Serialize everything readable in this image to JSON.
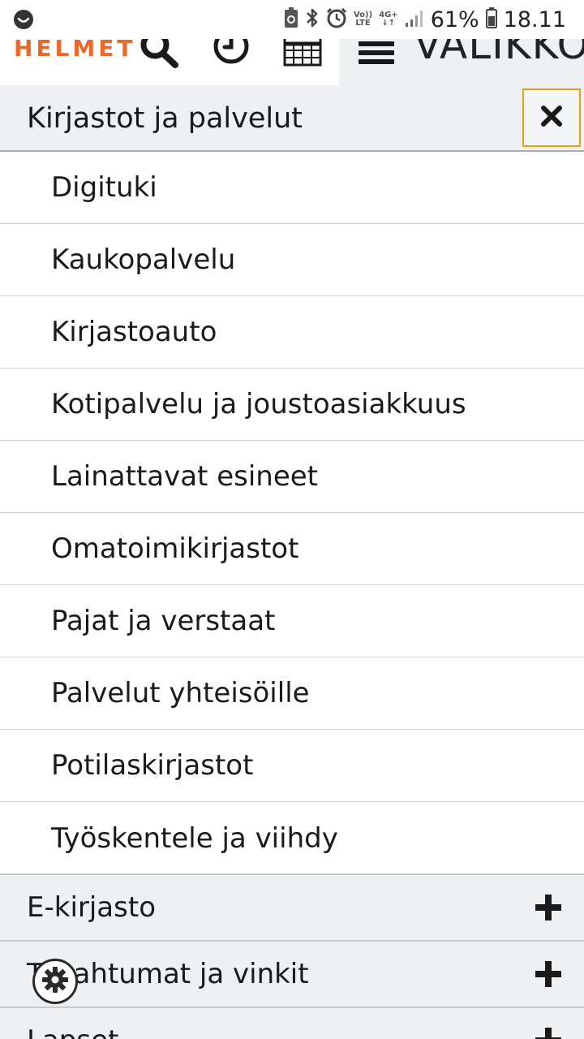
{
  "status_bar": {
    "battery_percent": "61%",
    "time": "18.11",
    "volte_line1": "Vo))",
    "volte_line2": "LTE",
    "network_line1": "4G+",
    "network_line2": "↓↑"
  },
  "header": {
    "logo_text": "HELMET",
    "menu_label": "VALIKKO"
  },
  "section": {
    "title": "Kirjastot ja palvelut"
  },
  "sub_items": [
    {
      "label": "Digituki"
    },
    {
      "label": "Kaukopalvelu"
    },
    {
      "label": "Kirjastoauto"
    },
    {
      "label": "Kotipalvelu ja joustoasiakkuus"
    },
    {
      "label": "Lainattavat esineet"
    },
    {
      "label": "Omatoimikirjastot"
    },
    {
      "label": "Pajat ja verstaat"
    },
    {
      "label": "Palvelut yhteisöille"
    },
    {
      "label": "Potilaskirjastot"
    },
    {
      "label": "Työskentele ja viihdy"
    }
  ],
  "categories": [
    {
      "label": "E-kirjasto"
    },
    {
      "label": "Tapahtumat ja vinkit"
    },
    {
      "label": "Lapset"
    }
  ],
  "colors": {
    "brand_orange": "#e9692c",
    "focus_outline": "#e0a21e",
    "panel_gray": "#eef0f2"
  },
  "icons": {
    "status_left": "face-icon",
    "header_search": "search-icon",
    "header_history": "clock-icon",
    "header_calendar": "calendar-icon",
    "header_menu": "hamburger-icon",
    "close": "close-icon",
    "expand": "plus-icon",
    "settings": "gear-icon"
  }
}
